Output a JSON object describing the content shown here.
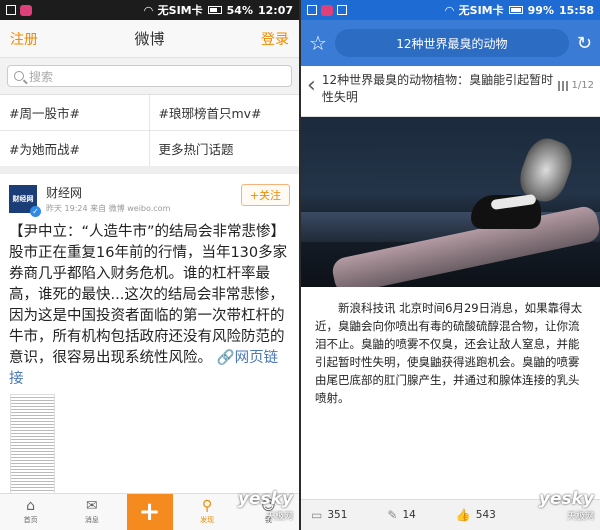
{
  "left": {
    "status": {
      "carrier": "无SIM卡",
      "battery": "54%",
      "time": "12:07"
    },
    "header": {
      "register": "注册",
      "title": "微博",
      "login": "登录"
    },
    "search": {
      "placeholder": "搜索"
    },
    "topics": [
      "#周一股市#",
      "#琅琊榜首只mv#",
      "#为她而战#",
      "更多热门话题"
    ],
    "post": {
      "avatar_text": "财经网",
      "author": "财经网",
      "meta": "昨天 19:24  来自 微博 weibo.com",
      "follow": "+关注",
      "text": "【尹中立：“人造牛市”的结局会非常悲惨】股市正在重复16年前的行情，当年130多家券商几乎都陷入财务危机。谁的杠杆率最高，谁死的最快...这次的结局会非常悲惨，因为这是中国投资者面临的第一次带杠杆的牛市，所有机构包括政府还没有风险防范的意识，很容易出现系统性风险。",
      "link": "网页链接"
    },
    "tabs": [
      {
        "label": "首页",
        "icon": "home-icon"
      },
      {
        "label": "消息",
        "icon": "mail-icon"
      },
      {
        "label": "+",
        "icon": "plus-icon"
      },
      {
        "label": "发现",
        "icon": "discover-icon"
      },
      {
        "label": "我",
        "icon": "me-icon"
      }
    ],
    "watermark": {
      "brand": "yesky",
      "sub": "天极网"
    }
  },
  "right": {
    "status": {
      "carrier": "无SIM卡",
      "battery": "99%",
      "time": "15:58"
    },
    "header": {
      "pill": "12种世界最臭的动物"
    },
    "article": {
      "title": "12种世界最臭的动物植物：臭鼬能引起暂时性失明",
      "pager": "1/12",
      "body": "新浪科技讯 北京时间6月29日消息，如果靠得太近，臭鼬会向你喷出有毒的硫酸硫醇混合物，让你流泪不止。臭鼬的喷雾不仅臭，还会让敌人窒息，并能引起暂时性失明，使臭鼬获得逃跑机会。臭鼬的喷雾由尾巴底部的肛门腺产生，并通过和腺体连接的乳头喷射。"
    },
    "bottom": {
      "comments": "351",
      "shares": "14",
      "likes": "543"
    },
    "watermark": {
      "brand": "yesky",
      "sub": "天极网"
    }
  },
  "colors": {
    "weibo_orange": "#f08a00",
    "news_blue": "#3a7bd5"
  }
}
